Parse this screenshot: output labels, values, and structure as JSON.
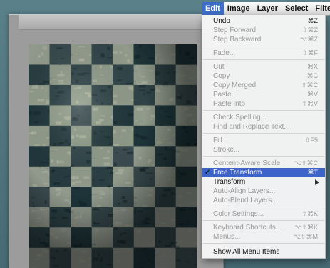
{
  "menubar": {
    "items": [
      {
        "label": "Edit",
        "active": true
      },
      {
        "label": "Image"
      },
      {
        "label": "Layer"
      },
      {
        "label": "Select"
      },
      {
        "label": "Filte"
      }
    ]
  },
  "edit_menu": {
    "groups": [
      [
        {
          "label": "Undo",
          "shortcut": "⌘Z",
          "enabled": true
        },
        {
          "label": "Step Forward",
          "shortcut": "⇧⌘Z",
          "enabled": false
        },
        {
          "label": "Step Backward",
          "shortcut": "⌥⌘Z",
          "enabled": false
        }
      ],
      [
        {
          "label": "Fade...",
          "shortcut": "⇧⌘F",
          "enabled": false
        }
      ],
      [
        {
          "label": "Cut",
          "shortcut": "⌘X",
          "enabled": false
        },
        {
          "label": "Copy",
          "shortcut": "⌘C",
          "enabled": false
        },
        {
          "label": "Copy Merged",
          "shortcut": "⇧⌘C",
          "enabled": false
        },
        {
          "label": "Paste",
          "shortcut": "⌘V",
          "enabled": false
        },
        {
          "label": "Paste Into",
          "shortcut": "⇧⌘V",
          "enabled": false
        }
      ],
      [
        {
          "label": "Check Spelling...",
          "shortcut": "",
          "enabled": false
        },
        {
          "label": "Find and Replace Text...",
          "shortcut": "",
          "enabled": false
        }
      ],
      [
        {
          "label": "Fill...",
          "shortcut": "⇧F5",
          "enabled": false
        },
        {
          "label": "Stroke...",
          "shortcut": "",
          "enabled": false
        }
      ],
      [
        {
          "label": "Content-Aware Scale",
          "shortcut": "⌥⇧⌘C",
          "enabled": false
        },
        {
          "label": "Free Transform",
          "shortcut": "⌘T",
          "enabled": true,
          "selected": true,
          "checked": true
        },
        {
          "label": "Transform",
          "shortcut": "",
          "enabled": true,
          "submenu": true
        },
        {
          "label": "Auto-Align Layers...",
          "shortcut": "",
          "enabled": false
        },
        {
          "label": "Auto-Blend Layers...",
          "shortcut": "",
          "enabled": false
        }
      ],
      [
        {
          "label": "Color Settings...",
          "shortcut": "⇧⌘K",
          "enabled": false
        }
      ],
      [
        {
          "label": "Keyboard Shortcuts...",
          "shortcut": "⌥⇧⌘K",
          "enabled": false
        },
        {
          "label": "Menus...",
          "shortcut": "⌥⇧⌘M",
          "enabled": false
        }
      ],
      [
        {
          "label": "Show All Menu Items",
          "shortcut": "",
          "enabled": true
        }
      ]
    ]
  },
  "colors": {
    "selection": "#3d64c8",
    "desktop": "#4f7680",
    "checker_light": "#8d9a86",
    "checker_dark": "#1c3338"
  }
}
